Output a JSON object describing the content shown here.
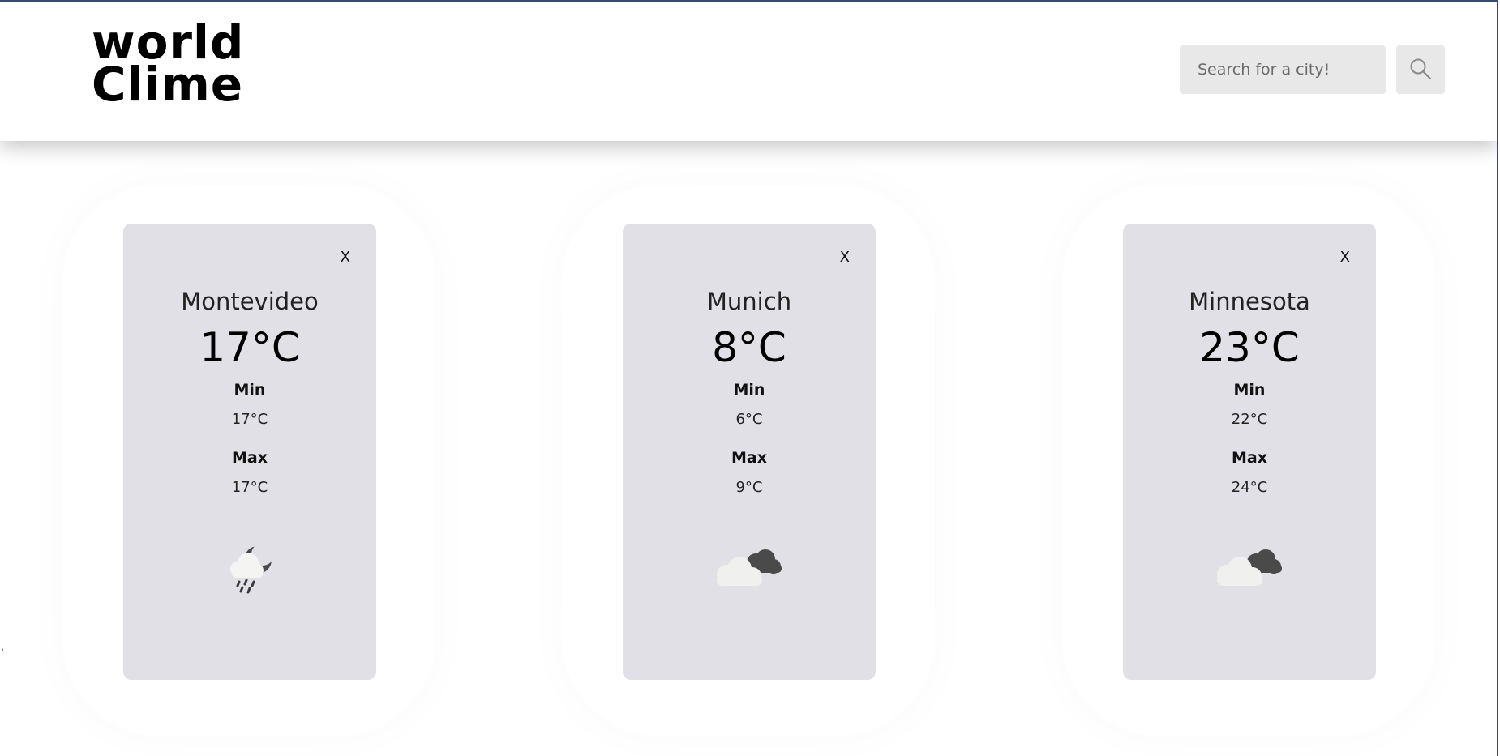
{
  "app": {
    "logo_line1": "world",
    "logo_line2": "Clime"
  },
  "search": {
    "placeholder": "Search for a city!",
    "value": "",
    "button_icon": "search-icon"
  },
  "cards": [
    {
      "city": "Montevideo",
      "temp": "17°C",
      "min_label": "Min",
      "min": "17°C",
      "max_label": "Max",
      "max": "17°C",
      "close_label": "X",
      "icon": "rain-night-icon"
    },
    {
      "city": "Munich",
      "temp": "8°C",
      "min_label": "Min",
      "min": "6°C",
      "max_label": "Max",
      "max": "9°C",
      "close_label": "X",
      "icon": "cloudy-icon"
    },
    {
      "city": "Minnesota",
      "temp": "23°C",
      "min_label": "Min",
      "min": "22°C",
      "max_label": "Max",
      "max": "24°C",
      "close_label": "X",
      "icon": "cloudy-icon"
    }
  ],
  "stray_text": ",",
  "colors": {
    "card_bg": "#e0e0e6",
    "input_bg": "#e8e8e8",
    "window_border": "#3b4a6b"
  }
}
